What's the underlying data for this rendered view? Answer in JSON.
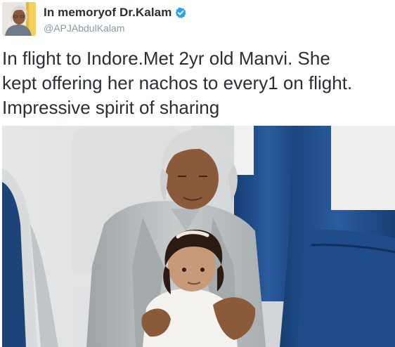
{
  "tweet": {
    "author": {
      "display_name": "In memoryof Dr.Kalam",
      "handle": "@APJAbdulKalam",
      "verified": true,
      "verified_color": "#2aa3ef"
    },
    "text": "In flight to Indore.Met 2yr old Manvi. She\nkept offering her nachos to every1 on flight.\nImpressive spirit of sharing"
  },
  "icons": {
    "verified": "verified-badge-icon",
    "avatar": "profile-avatar"
  },
  "colors": {
    "name": "#292f33",
    "handle": "#8899a6",
    "text": "#292f33",
    "seat": "#1d4f8c"
  }
}
